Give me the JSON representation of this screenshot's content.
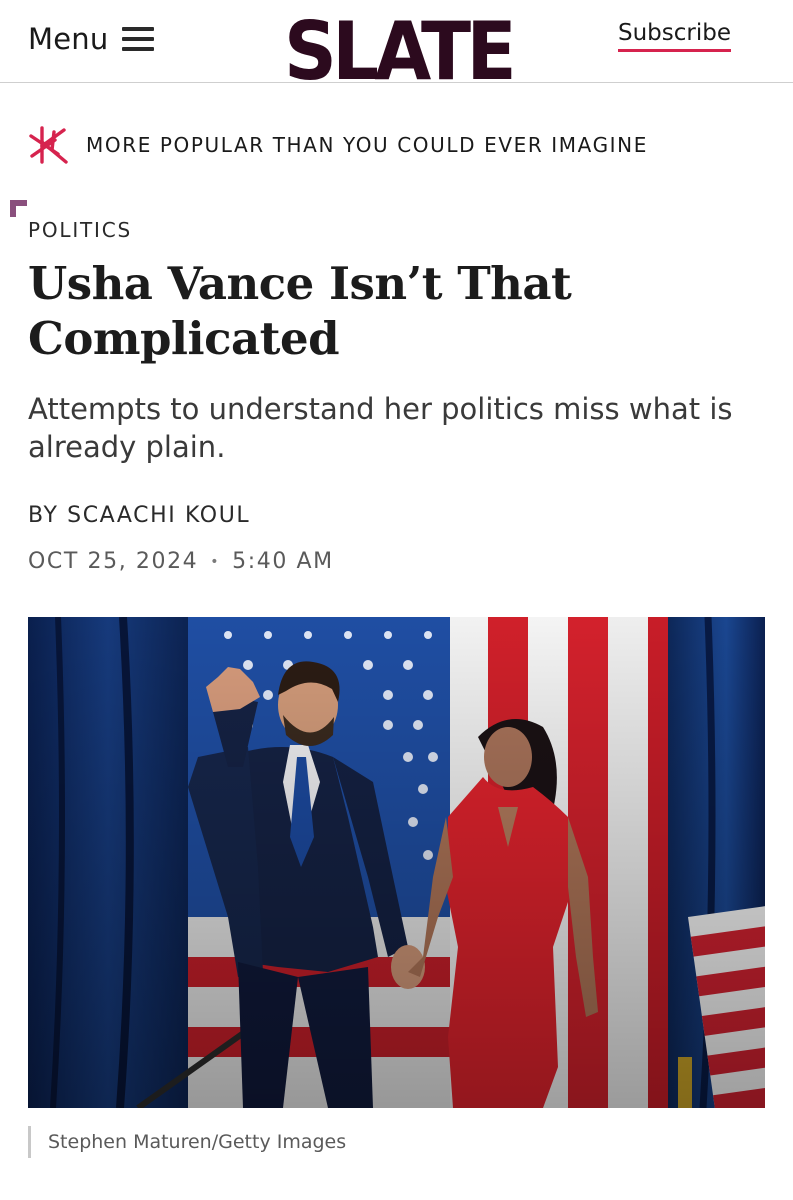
{
  "header": {
    "menu_label": "Menu",
    "brand": "SLATE",
    "subscribe_label": "Subscribe",
    "accent_color": "#d6234e",
    "brand_color": "#2c0a1e"
  },
  "kicker": {
    "text": "MORE POPULAR THAN YOU COULD EVER IMAGINE",
    "icon": "slate-star-icon",
    "icon_color": "#d6234e"
  },
  "article": {
    "section": "POLITICS",
    "headline": "Usha Vance Isn’t That Complicated",
    "dek": "Attempts to understand her politics miss what is already plain.",
    "byline_prefix": "BY",
    "author": "SCAACHI KOUL",
    "date": "OCT 25, 2024",
    "date_separator": "•",
    "time": "5:40 AM"
  },
  "photo": {
    "caption": "Stephen Maturen/Getty Images"
  }
}
